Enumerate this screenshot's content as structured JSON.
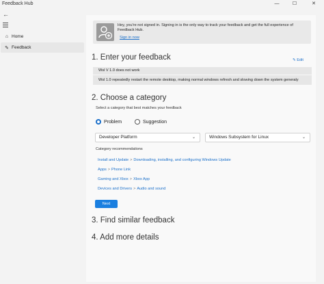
{
  "window": {
    "title": "Feedback Hub",
    "minimize": "—",
    "maximize": "☐",
    "close": "✕"
  },
  "nav": {
    "back_icon": "←",
    "menu_icon": "hamburger-icon",
    "items": [
      {
        "label": "Home",
        "icon": "home-icon",
        "glyph": "⌂"
      },
      {
        "label": "Feedback",
        "icon": "feedback-icon",
        "glyph": "✎"
      }
    ]
  },
  "banner": {
    "text": "Hey, you're not signed in. Signing in is the only way to track your feedback and get the full experience of Feedback Hub.",
    "link": "Sign in now"
  },
  "step1": {
    "title": "1. Enter your feedback",
    "edit_label": "✎ Edit",
    "summary": "Wsl V 1.0 does not work",
    "description": "Wsl 1.0 repeatedly restart the remote desktop, making normal windows refresh and slowing down the system generaly"
  },
  "step2": {
    "title": "2. Choose a category",
    "subtitle": "Select a category that best matches your feedback",
    "types": [
      {
        "label": "Problem",
        "selected": true
      },
      {
        "label": "Suggestion",
        "selected": false
      }
    ],
    "category": "Developer Platform",
    "subcategory": "Windows Subsystem for Linux",
    "chevron": "⌄",
    "recommendations_label": "Category recommendations",
    "recommendations": [
      {
        "category": "Install and Update",
        "sub": "Downloading, installing, and configuring Windows Update"
      },
      {
        "category": "Apps",
        "sub": "Phone Link"
      },
      {
        "category": "Gaming and Xbox",
        "sub": "Xbox App"
      },
      {
        "category": "Devices and Drivers",
        "sub": "Audio and sound"
      }
    ],
    "separator": ">",
    "next_label": "Next"
  },
  "step3": {
    "title": "3. Find similar feedback"
  },
  "step4": {
    "title": "4. Add more details"
  },
  "colors": {
    "accent": "#1a7fe0",
    "link": "#1a6fc9"
  }
}
